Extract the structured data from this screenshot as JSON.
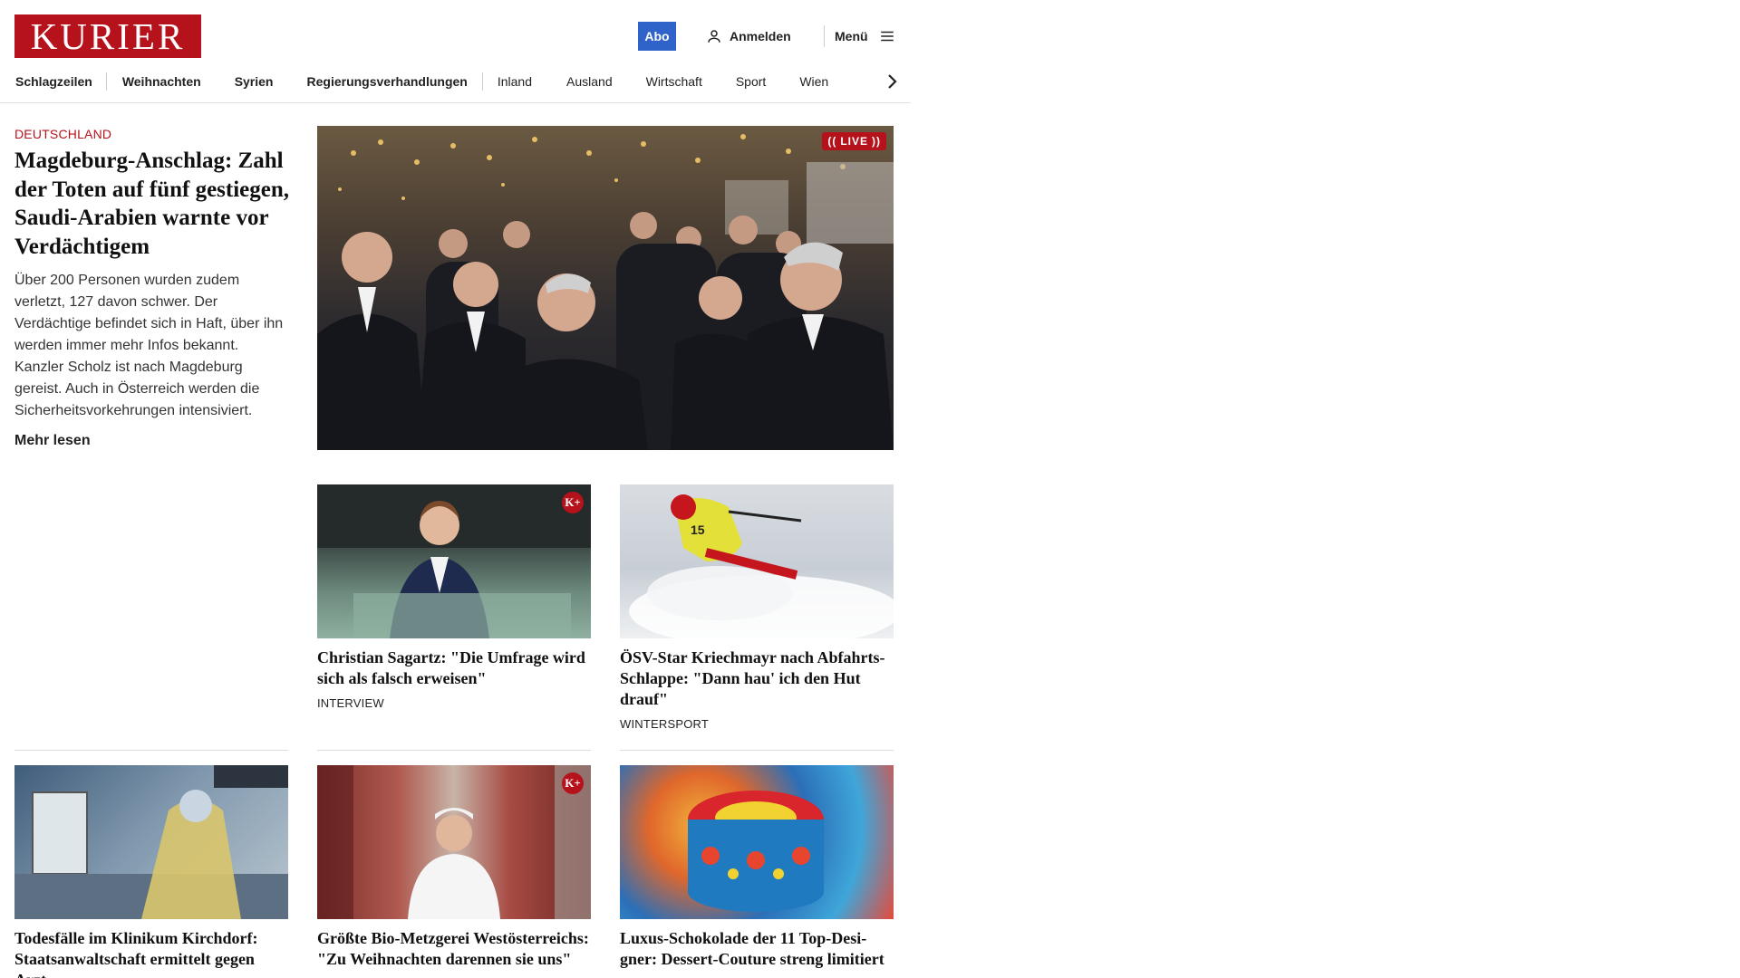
{
  "header": {
    "logo_text": "KURIER",
    "abo_label": "Abo",
    "login_label": "Anmelden",
    "menu_label": "Menü",
    "icons": {
      "login": "user-icon",
      "menu": "hamburger-icon",
      "nav_next": "chevron-right-icon"
    }
  },
  "nav": {
    "items": [
      {
        "label": "Schlagzeilen"
      },
      {
        "label": "Weihnachten"
      },
      {
        "label": "Syrien"
      },
      {
        "label": "Regierungsverhandlungen"
      },
      {
        "label": "Inland"
      },
      {
        "label": "Ausland"
      },
      {
        "label": "Wirtschaft"
      },
      {
        "label": "Sport"
      },
      {
        "label": "Wien"
      }
    ]
  },
  "lead": {
    "kicker": "DEUTSCHLAND",
    "title": "Magdeburg-Anschlag: Zahl der Toten auf fünf gestiegen, Saudi-Arabien warnte vor Verdächtigem",
    "teaser": "Über 200 Personen wurden zudem verletzt, 127 davon schwer. Der Verdächtige befindet sich in Haft, über ihn werden immer mehr Infos bekannt. Kanzler Scholz ist nach Magdeburg gereist. Auch in Österreich werden die Sicherheitsvorkehrungen intensiviert.",
    "more_label": "Mehr lesen",
    "live_label": "LIVE"
  },
  "cards": [
    {
      "title": "Christian Sagartz: \"Die Umfrage wird sich als falsch erweisen\"",
      "label": "INTERVIEW",
      "kplus": "K+"
    },
    {
      "title": "ÖSV-Star Kriechmayr nach Ab­fahrts-Schlappe: \"Dann hau' ich den Hut drauf\"",
      "label": "WINTERSPORT"
    },
    {
      "title": "Todesfälle im Klinikum Kirchdorf: Staatsanwaltschaft ermittelt gegen Arzt"
    },
    {
      "title": "Größte Bio-Metzgerei Westöster­reichs: \"Zu Weihnachten darennen sie uns\"",
      "kplus": "K+"
    },
    {
      "title": "Luxus-Schokolade der 11 Top-Desi­gner: Dessert-Couture streng limitiert"
    }
  ],
  "colors": {
    "brand_red": "#b5121b",
    "abo_blue": "#2f63c9"
  }
}
